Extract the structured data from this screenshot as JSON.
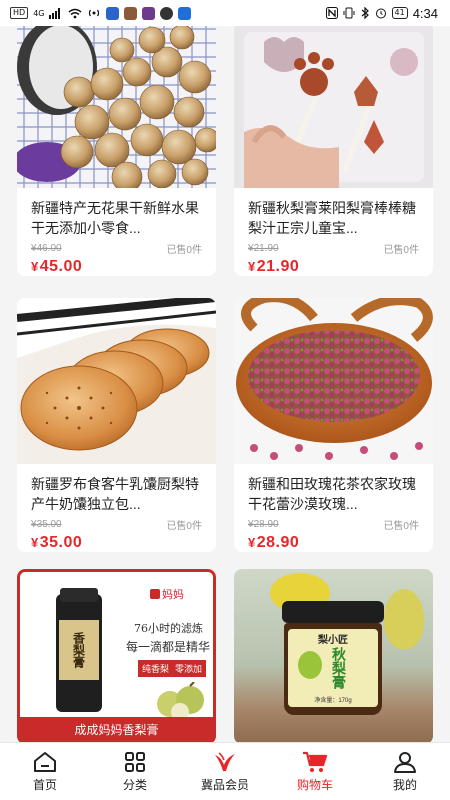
{
  "status_bar": {
    "left_chip": "HD",
    "network": "4G",
    "battery": "41",
    "time": "4:34"
  },
  "products": [
    {
      "title": "新疆特产无花果干新鲜水果干无添加小零食...",
      "old_price": "46.00",
      "sold": "已售0件",
      "currency": "¥",
      "price": "45.00"
    },
    {
      "title": "新疆秋梨膏莱阳梨膏棒棒糖梨汁正宗儿童宝...",
      "old_price": "21.90",
      "sold": "已售0件",
      "currency": "¥",
      "price": "21.90"
    },
    {
      "title": "新疆罗布食客牛乳馕厨梨特产牛奶馕独立包...",
      "old_price": "35.00",
      "sold": "已售0件",
      "currency": "¥",
      "price": "35.00"
    },
    {
      "title": "新疆和田玫瑰花茶农家玫瑰干花蕾沙漠玫瑰...",
      "old_price": "28.90",
      "sold": "已售0件",
      "currency": "¥",
      "price": "28.90"
    },
    {
      "image_text": {
        "brand": "妈妈",
        "jar_label": "香梨膏",
        "slogan1": "76小时的滤炼",
        "slogan2": "每一滴都是精华",
        "tag1": "纯香梨",
        "tag2": "零添加",
        "footer": "成成妈妈香梨膏"
      }
    },
    {
      "image_text": {
        "brand": "梨小匠",
        "jar_label": "秋梨膏",
        "weight": "净含量：170g"
      }
    }
  ],
  "tabbar": {
    "items": [
      {
        "label": "首页",
        "icon": "home-icon",
        "active": false
      },
      {
        "label": "分类",
        "icon": "category-icon",
        "active": false
      },
      {
        "label": "冀品会员",
        "icon": "member-icon",
        "active": false
      },
      {
        "label": "购物车",
        "icon": "cart-icon",
        "active": true
      },
      {
        "label": "我的",
        "icon": "user-icon",
        "active": false
      }
    ]
  },
  "colors": {
    "accent": "#e8262a",
    "muted": "#9a9a9a",
    "background": "#f4f4f4"
  }
}
